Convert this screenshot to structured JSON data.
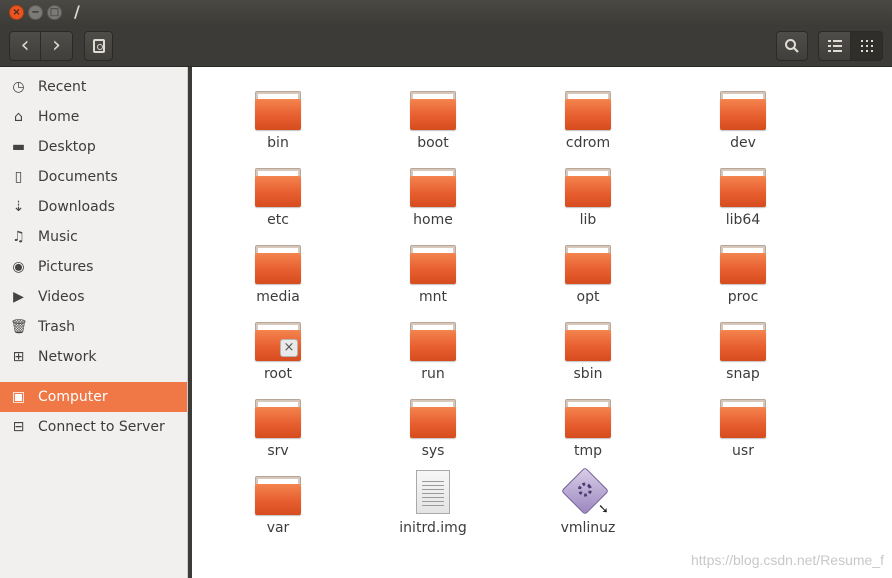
{
  "window": {
    "title": "/",
    "buttons": {
      "close": "×",
      "minimize": "−",
      "maximize": "□"
    }
  },
  "toolbar": {
    "back": "‹",
    "forward": "›",
    "search_icon": "search-icon",
    "list_view_icon": "list-view-icon",
    "grid_view_icon": "grid-view-icon"
  },
  "sidebar": {
    "items": [
      {
        "label": "Recent",
        "icon": "◷"
      },
      {
        "label": "Home",
        "icon": "⌂"
      },
      {
        "label": "Desktop",
        "icon": "▬"
      },
      {
        "label": "Documents",
        "icon": "▯"
      },
      {
        "label": "Downloads",
        "icon": "⇣"
      },
      {
        "label": "Music",
        "icon": "♫"
      },
      {
        "label": "Pictures",
        "icon": "◉"
      },
      {
        "label": "Videos",
        "icon": "▶"
      },
      {
        "label": "Trash",
        "icon": "🗑"
      },
      {
        "label": "Network",
        "icon": "⊞"
      },
      {
        "label": "Computer",
        "icon": "▣",
        "active": true
      },
      {
        "label": "Connect to Server",
        "icon": "⊟"
      }
    ]
  },
  "files": [
    {
      "name": "bin",
      "kind": "folder"
    },
    {
      "name": "boot",
      "kind": "folder"
    },
    {
      "name": "cdrom",
      "kind": "folder"
    },
    {
      "name": "dev",
      "kind": "folder"
    },
    {
      "name": "etc",
      "kind": "folder"
    },
    {
      "name": "home",
      "kind": "folder"
    },
    {
      "name": "lib",
      "kind": "folder"
    },
    {
      "name": "lib64",
      "kind": "folder"
    },
    {
      "name": "media",
      "kind": "folder"
    },
    {
      "name": "mnt",
      "kind": "folder"
    },
    {
      "name": "opt",
      "kind": "folder"
    },
    {
      "name": "proc",
      "kind": "folder"
    },
    {
      "name": "root",
      "kind": "folder-locked"
    },
    {
      "name": "run",
      "kind": "folder"
    },
    {
      "name": "sbin",
      "kind": "folder"
    },
    {
      "name": "snap",
      "kind": "folder"
    },
    {
      "name": "srv",
      "kind": "folder"
    },
    {
      "name": "sys",
      "kind": "folder"
    },
    {
      "name": "tmp",
      "kind": "folder"
    },
    {
      "name": "usr",
      "kind": "folder"
    },
    {
      "name": "var",
      "kind": "folder"
    },
    {
      "name": "initrd.img",
      "kind": "document"
    },
    {
      "name": "vmlinuz",
      "kind": "binary"
    }
  ],
  "watermark": "https://blog.csdn.net/Resume_f"
}
